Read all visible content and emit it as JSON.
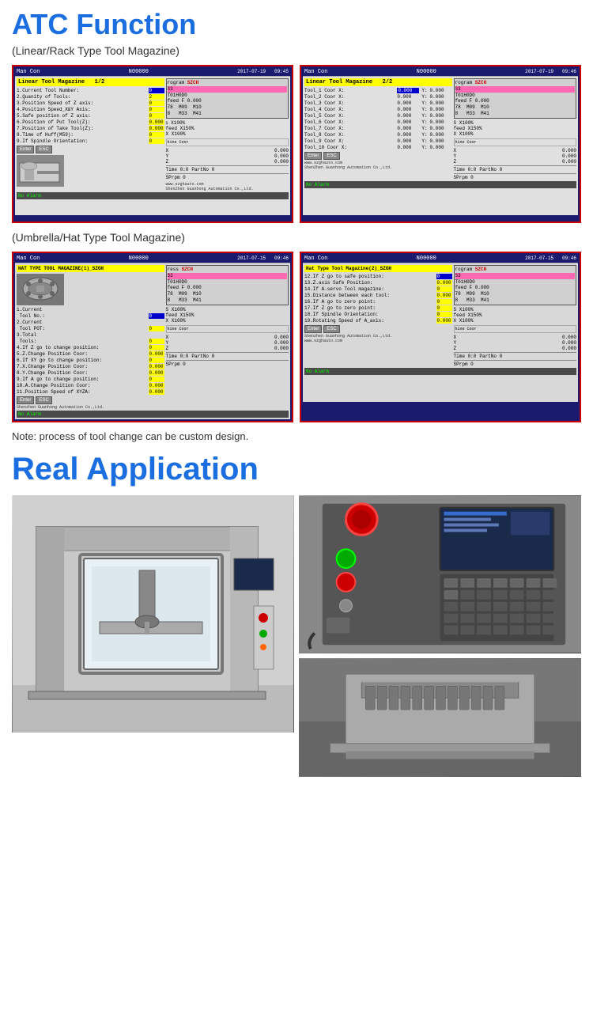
{
  "page": {
    "title": "ATC Function",
    "subtitle": "(Linear/Rack Type Tool Magazine)",
    "subtitle2": "(Umbrella/Hat Type Tool Magazine)",
    "note": "Note: process of tool change can be custom design.",
    "real_app_title": "Real Application"
  },
  "screens": {
    "linear_1": {
      "mode": "Man Con",
      "program_num": "N00000",
      "date": "2017-07-19",
      "time": "09:45",
      "page": "1/2",
      "magazine_label": "Linear Tool Magazine",
      "fields": [
        {
          "label": "1.Current Tool Number:",
          "val": "0",
          "highlight": true
        },
        {
          "label": "2.Quanity of Tools:",
          "val": "2"
        },
        {
          "label": "3.Position Speed of Z axis:",
          "val": "0"
        },
        {
          "label": "4.Position Speed_X&Y Axis:",
          "val": "0"
        },
        {
          "label": "5.Safe position of Z axis:",
          "val": "0.000"
        },
        {
          "label": "6.Position of Put Tool(Z):",
          "val": "0.000"
        },
        {
          "label": "7.Position of Take Tool(Z):",
          "val": "0.000"
        },
        {
          "label": "8.Time of Huff(M59):",
          "val": "0"
        },
        {
          "label": "9.If Spindle Orientation:",
          "val": "0"
        }
      ],
      "program": "SZCH",
      "prog_lines": [
        "S3",
        "T01H0D0",
        "feed F 0.000",
        "78  M09  M10",
        "8   M33  M41"
      ],
      "spindle": "X100%",
      "feed_override": "X150%",
      "x_override": "X100%",
      "coords": {
        "x": "0.000",
        "y": "0.000",
        "z": "0.000"
      },
      "time_val": "0:0",
      "partno": "0",
      "sprpm": "0",
      "alarm": "No Alarm",
      "website": "www.szghauto.com",
      "company": "ShenZhen Guanhong Automation Co.,Ltd."
    },
    "linear_2": {
      "mode": "Man Con",
      "program_num": "N00000",
      "date": "2017-07-19",
      "time": "09:46",
      "page": "2/2",
      "magazine_label": "Linear Tool Magazine",
      "tools": [
        {
          "label": "Tool_1 Coor X:",
          "x": "0.000",
          "y": "0.000"
        },
        {
          "label": "Tool_2 Coor X:",
          "x": "0.000",
          "y": "0.000"
        },
        {
          "label": "Tool_3 Coor X:",
          "x": "0.000",
          "y": "0.000"
        },
        {
          "label": "Tool_4 Coor X:",
          "x": "0.000",
          "y": "0.000"
        },
        {
          "label": "Tool_5 Coor X:",
          "x": "0.000",
          "y": "0.000"
        },
        {
          "label": "Tool_6 Coor X:",
          "x": "0.000",
          "y": "0.000"
        },
        {
          "label": "Tool_7 Coor X:",
          "x": "0.000",
          "y": "0.000"
        },
        {
          "label": "Tool_8 Coor X:",
          "x": "0.000",
          "y": "0.000"
        },
        {
          "label": "Tool_9 Coor X:",
          "x": "0.000",
          "y": "0.000"
        },
        {
          "label": "Tool_10 Coor X:",
          "x": "0.000",
          "y": "0.000"
        }
      ],
      "program": "SZCH",
      "prog_lines": [
        "S3",
        "T01H0D0",
        "feed F 0.000",
        "78  M09  M10",
        "8   M33  M41"
      ],
      "spindle": "X100%",
      "feed_override": "X150%",
      "x_override": "X100%",
      "coords": {
        "x": "0.000",
        "y": "0.000",
        "z": "0.000"
      },
      "time_val": "0:0",
      "partno": "0",
      "sprpm": "0",
      "alarm": "No Alarm",
      "website": "www.szghauto.com",
      "company": "ShenZhen Guanhong Automation Co.,Ltd."
    },
    "umbrella_1": {
      "mode": "Man Con",
      "program_num": "N00000",
      "date": "2017-07-15",
      "time": "09:46",
      "magazine_label": "HAT TYPE TOOL MAGAZINE(1)_SZGH",
      "fields": [
        {
          "label": "1.Current",
          "sub": "Tool No.:",
          "val": "0",
          "highlight": true
        },
        {
          "label": "2.Current",
          "sub": "Tool POT:",
          "val": "0"
        },
        {
          "label": "3.Total",
          "sub": "Tools:",
          "val": "0"
        },
        {
          "label": "4.If Z go to change position:",
          "val": "0"
        },
        {
          "label": "5.Z.Change Position Coor:",
          "val": "0.000"
        },
        {
          "label": "6.If XY go to change position:",
          "val": "0"
        },
        {
          "label": "7.X.Change Position Coor:",
          "val": "0.000"
        },
        {
          "label": "8.Y.Change Position Coor:",
          "val": "0.000"
        },
        {
          "label": "9.If A go to change position:",
          "val": "0"
        },
        {
          "label": "10.A.Change Position Coor:",
          "val": "0.000"
        },
        {
          "label": "11.Position Speed of XYZA:",
          "val": "0.000"
        }
      ],
      "program": "SZCH",
      "prog_lines": [
        "S3",
        "T01H0D0",
        "feed F 0.000",
        "78  M09  M10",
        "8   M33  M41"
      ],
      "spindle": "X100%",
      "feed_override": "X150%",
      "x_override": "X100%",
      "coords": {
        "x": "0.000",
        "y": "0.000",
        "z": "0.000"
      },
      "time_val": "0:0",
      "partno": "0",
      "sprpm": "0",
      "alarm": "No Alarm",
      "company": "Shenzhen Guanhong Automation Co.,Ltd."
    },
    "umbrella_2": {
      "mode": "Man Con",
      "program_num": "N00000",
      "date": "2017-07-15",
      "time": "09:46",
      "magazine_label": "Hat Type Tool Magazine(2)_SZGH",
      "fields": [
        {
          "label": "12.If Z go to safe position:",
          "val": "0",
          "highlight": true
        },
        {
          "label": "13.Z.axis Safe Position:",
          "val": "0.000"
        },
        {
          "label": "14.If A.servo Tool magazine:",
          "val": "0"
        },
        {
          "label": "15.Distance between each tool:",
          "val": "0.000"
        },
        {
          "label": "16.If A go to zero point:",
          "val": "0"
        },
        {
          "label": "17.If Z go to zero point:",
          "val": "0"
        },
        {
          "label": "18.If Spindle Orientation:",
          "val": "0"
        },
        {
          "label": "19.Rotating Speed of A_axis:",
          "val": "0.000"
        }
      ],
      "program": "SZCH",
      "prog_lines": [
        "S3",
        "T01H0D0",
        "feed F 0.000",
        "78  M09  M10",
        "8   M33  M41"
      ],
      "spindle": "X100%",
      "feed_override": "X150%",
      "x_override": "X100%",
      "coords": {
        "x": "0.000",
        "y": "0.000",
        "z": "0.000"
      },
      "time_val": "0:0",
      "partno": "0",
      "sprpm": "0",
      "alarm": "No Alarm",
      "website": "www.szghauto.com",
      "company": "Shenzhen Guanhong Automation Co.,Ltd."
    }
  },
  "buttons": {
    "enter": "Enter",
    "esc": "ESC"
  },
  "photos": {
    "main_left_alt": "CNC machine with enclosure",
    "top_right_alt": "CNC control panel",
    "bottom_right_alt": "Tool magazine close-up"
  }
}
